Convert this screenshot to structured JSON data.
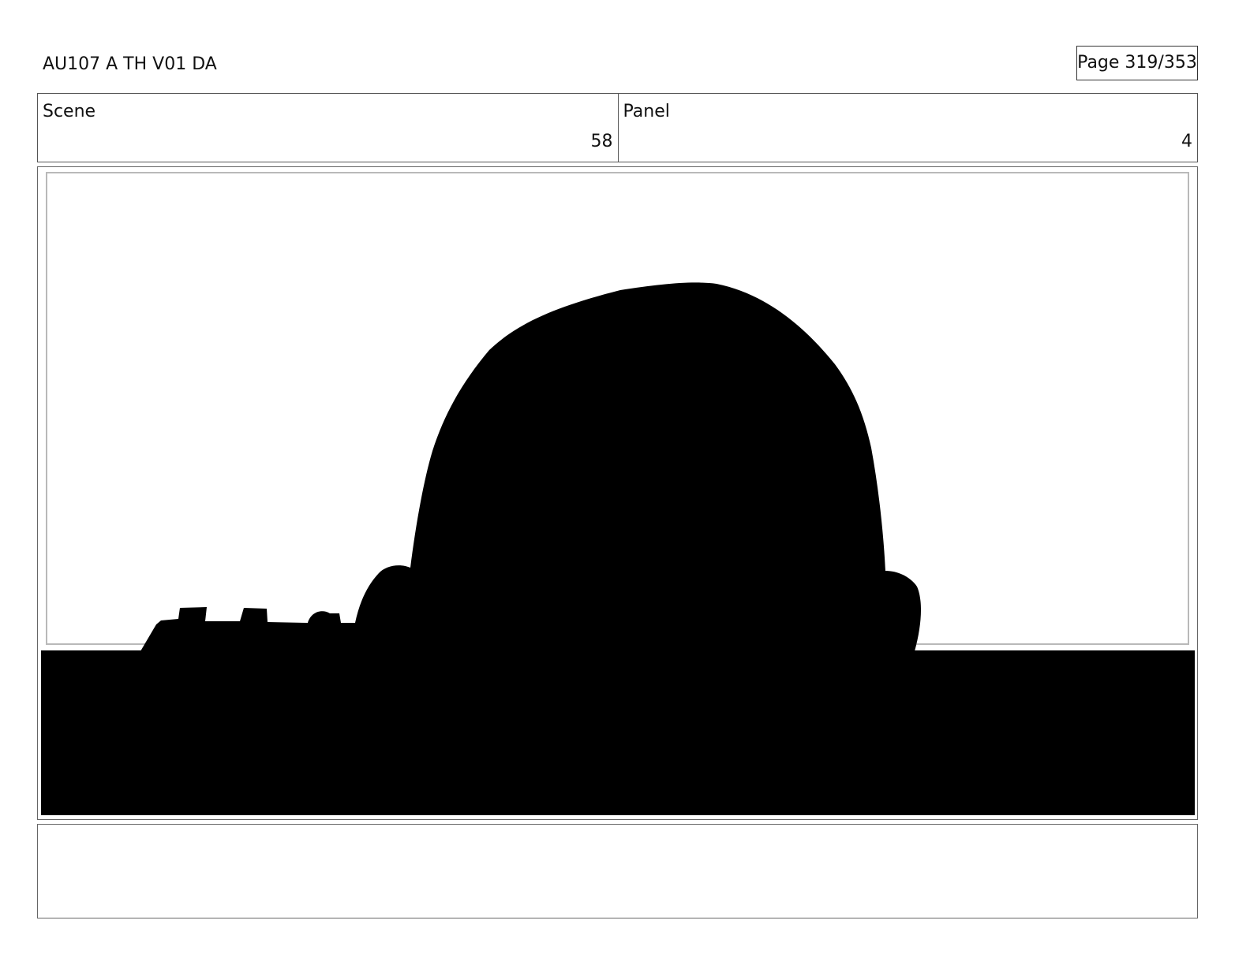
{
  "header": {
    "title": "AU107 A TH V01 DA",
    "page_label": "Page 319/353"
  },
  "info": {
    "scene_label": "Scene",
    "scene_value": "58",
    "panel_label": "Panel",
    "panel_value": "4"
  },
  "panel": {
    "art_description_icon": "silhouette-image",
    "fill_color": "#000000"
  },
  "caption": {
    "text": ""
  }
}
